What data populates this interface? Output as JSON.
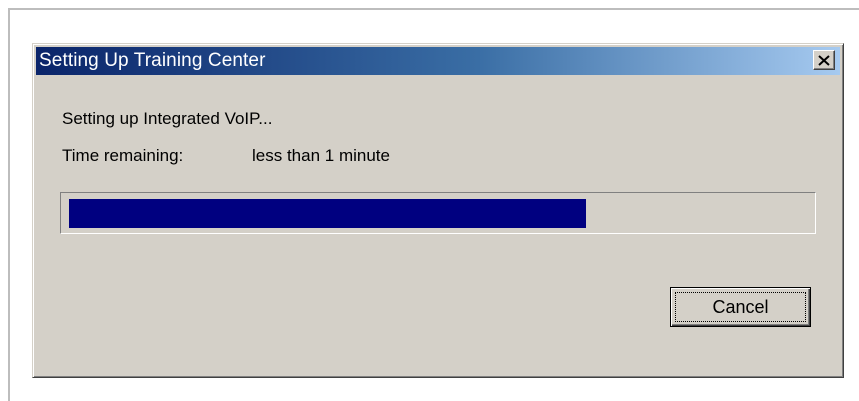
{
  "window": {
    "title": "Setting Up Training Center",
    "close_icon": "close-icon"
  },
  "status": {
    "message": "Setting up Integrated VoIP...",
    "time_label": "Time remaining:",
    "time_value": "less than 1 minute"
  },
  "progress": {
    "fraction": 0.7,
    "fill_color": "#000080"
  },
  "buttons": {
    "cancel_label": "Cancel"
  },
  "colors": {
    "dialog_face": "#d4d0c8",
    "title_gradient_start": "#0a246a",
    "title_gradient_end": "#a6caf0",
    "title_text": "#ffffff"
  }
}
